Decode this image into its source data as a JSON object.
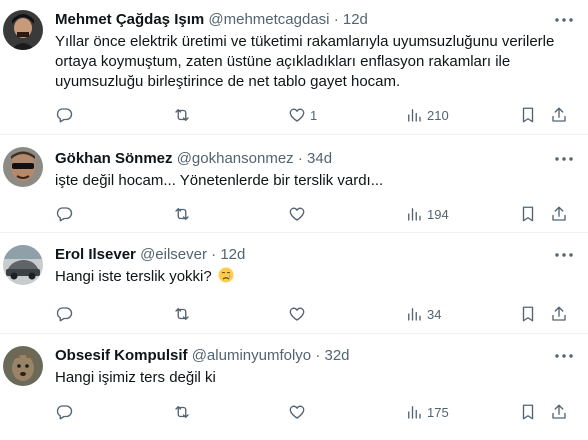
{
  "tweets": [
    {
      "name": "Mehmet Çağdaş Işım",
      "handle": "@mehmetcagdasi",
      "sep": "·",
      "time": "12d",
      "text": "Yıllar önce elektrik üretimi ve tüketimi rakamlarıyla uyumsuzluğunu verilerle ortaya koymuştum, zaten üstüne açıkladıkları enflasyon rakamları ile uyumsuzluğu birleştirince de net tablo gayet hocam.",
      "likes": "1",
      "views": "210",
      "avatar_icon": "avatar-dark-hair"
    },
    {
      "name": "Gökhan Sönmez",
      "handle": "@gokhansonmez",
      "sep": "·",
      "time": "34d",
      "text": "işte değil hocam... Yönetenlerde bir terslik vardı...",
      "likes": "",
      "views": "194",
      "avatar_icon": "avatar-sunglasses"
    },
    {
      "name": "Erol Ilsever",
      "handle": "@eilsever",
      "sep": "·",
      "time": "12d",
      "text": "Hangi iste terslik yokki?",
      "emoji": "crying-face-icon",
      "likes": "",
      "views": "34",
      "avatar_icon": "avatar-car"
    },
    {
      "name": "Obsesif Kompulsif",
      "handle": "@aluminyumfolyo",
      "sep": "·",
      "time": "32d",
      "text": "Hangi işimiz ters değil ki",
      "likes": "",
      "views": "175",
      "avatar_icon": "avatar-animal"
    }
  ]
}
